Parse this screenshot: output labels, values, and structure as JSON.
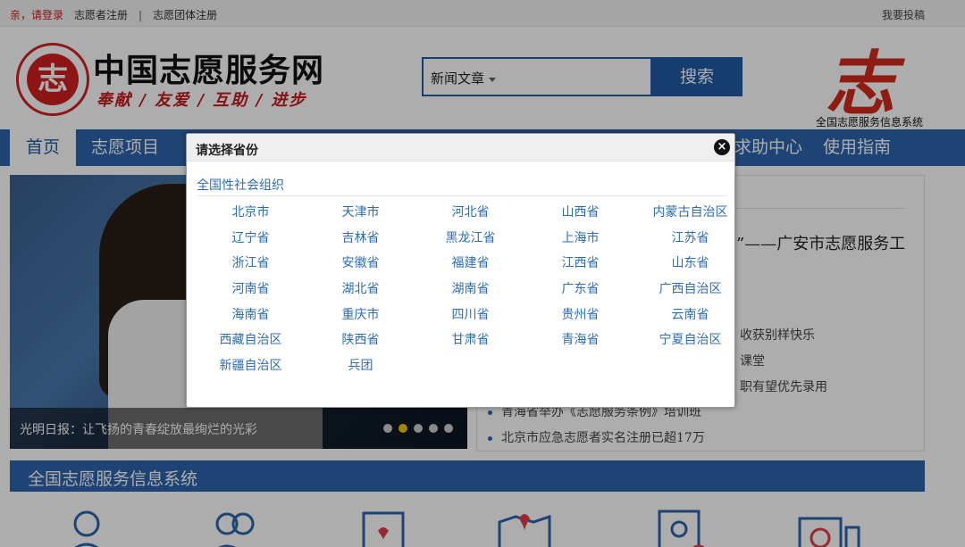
{
  "topbar": {
    "login": "亲，请登录",
    "volunteer_register": "志愿者注册",
    "separator": "|",
    "group_register": "志愿团体注册",
    "submit": "我要投稿"
  },
  "header": {
    "site_title": "中国志愿服务网",
    "slogan": "奉献 / 友爱 / 互助 / 进步",
    "seal_char": "志",
    "search_select": "新闻文章",
    "search_button": "搜索",
    "right_logo_char": "志",
    "right_logo_caption": "全国志愿服务信息系统"
  },
  "nav": {
    "items": [
      "首页",
      "志愿项目",
      "求助中心",
      "使用指南"
    ]
  },
  "banner": {
    "caption": "光明日报：让飞扬的青春绽放最绚烂的光彩"
  },
  "news": {
    "headline": "”——广安市志愿服务工",
    "fragments": [
      "收获别样快乐",
      "课堂",
      "职有望优先录用"
    ],
    "items": [
      "青海省举办《志愿服务条例》培训班",
      "北京市应急志愿者实名注册已超17万"
    ]
  },
  "section": {
    "title": "全国志愿服务信息系统"
  },
  "modal": {
    "title": "请选择省份",
    "close": "×",
    "org_link": "全国性社会组织",
    "provinces": [
      "北京市",
      "天津市",
      "河北省",
      "山西省",
      "内蒙古自治区",
      "辽宁省",
      "吉林省",
      "黑龙江省",
      "上海市",
      "江苏省",
      "浙江省",
      "安徽省",
      "福建省",
      "江西省",
      "山东省",
      "河南省",
      "湖北省",
      "湖南省",
      "广东省",
      "广西自治区",
      "海南省",
      "重庆市",
      "四川省",
      "贵州省",
      "云南省",
      "西藏自治区",
      "陕西省",
      "甘肃省",
      "青海省",
      "宁夏自治区",
      "新疆自治区",
      "兵团"
    ]
  },
  "colors": {
    "brand_blue": "#2d64ad",
    "link_blue": "#2d6db5",
    "brand_red": "#d21f1f"
  }
}
